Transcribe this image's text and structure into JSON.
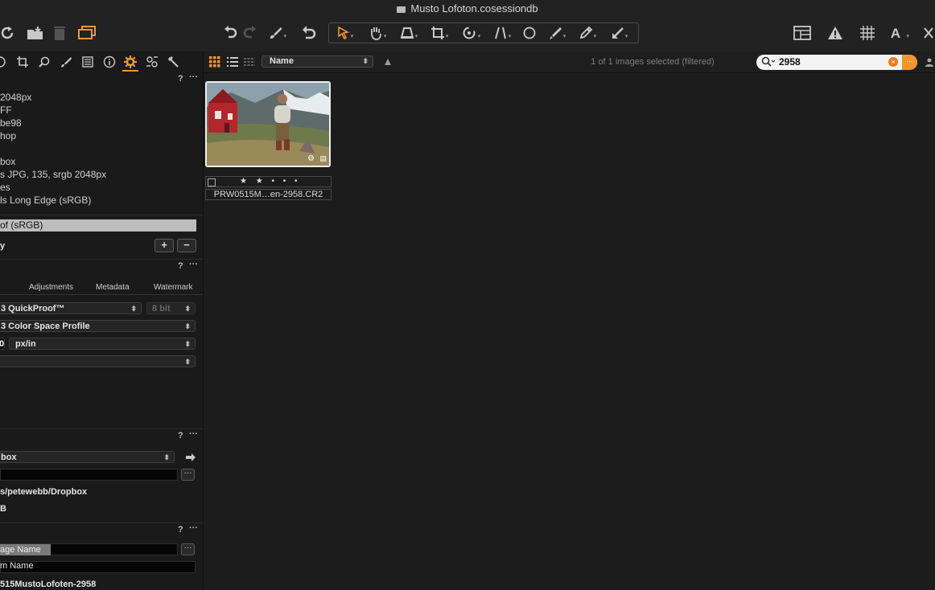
{
  "window": {
    "title": "Musto Lofoton.cosessiondb"
  },
  "toolbar": {
    "icons": [
      "rotate-icon",
      "import-folder-icon",
      "trash-icon",
      "multi-view-icon",
      "undo-icon",
      "redo-icon",
      "brush-icon",
      "reset-icon",
      "select-cursor-icon",
      "pan-hand-icon",
      "keystone-icon",
      "crop-icon",
      "rotate-tool-icon",
      "straighten-icon",
      "spot-circle-icon",
      "pen-icon",
      "color-picker-icon",
      "annotate-icon",
      "layout-icon",
      "warning-icon",
      "grid-icon",
      "text-icon"
    ]
  },
  "left_panel": {
    "tool_tabs": [
      "library",
      "crop",
      "search",
      "adjust",
      "details",
      "info",
      "output",
      "batch",
      "tools"
    ],
    "active_tab": "output",
    "info_lines": [
      "2048px",
      "FF",
      "be98",
      "hop",
      "",
      "box",
      "s JPG, 135, srgb 2048px",
      "es",
      "ls Long Edge (sRGB)"
    ],
    "selected_recipe": "of (sRGB)",
    "recipe_label": "y",
    "recipe_tabs": [
      "Adjustments",
      "Metadata",
      "Watermark"
    ],
    "format_select": "3 QuickProof™",
    "bit_depth": "8 bit",
    "profile_select": "3 Color Space Profile",
    "resolution_value": "0",
    "resolution_unit": "px/in",
    "location_select": "box",
    "location_path": "s/petewebb/Dropbox",
    "location_free": "B",
    "naming_token": "age Name",
    "naming_job": "m Name",
    "naming_sample": "515MustoLofoten-2958",
    "help_label": "?",
    "more_label": "···"
  },
  "browser": {
    "sort_by": "Name",
    "selection_status": "1 of 1 images selected (filtered)",
    "search_value": "2958",
    "image": {
      "filename": "PRW0515M…en-2958.CR2",
      "rating": 2,
      "rating_display": "★ ★ • • •"
    }
  },
  "colors": {
    "accent": "#f0962c",
    "background": "#1c1c1c",
    "panel": "#1a1a1a"
  }
}
